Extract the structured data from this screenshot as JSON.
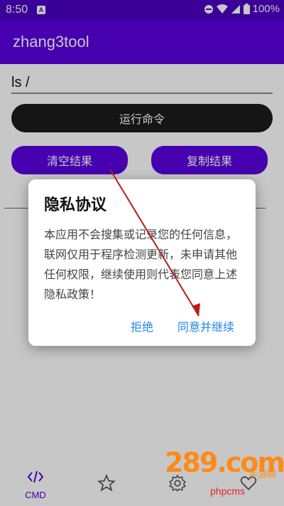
{
  "status_bar": {
    "time": "8:50",
    "notification_icon": "A",
    "battery": "100%"
  },
  "app_bar": {
    "title": "zhang3tool"
  },
  "command": {
    "value": "ls /"
  },
  "buttons": {
    "run": "运行命令",
    "clear": "清空结果",
    "copy": "复制结果"
  },
  "dialog": {
    "title": "隐私协议",
    "body": "本应用不会搜集或记录您的任何信息，联网仅用于程序检测更新，未申请其他任何权限，继续使用则代表您同意上述隐私政策！",
    "reject": "拒绝",
    "accept": "同意并继续"
  },
  "bottom_nav": {
    "cmd_label": "CMD"
  },
  "watermark": {
    "logo": "289.com",
    "sub": "手游网",
    "php": "phpcms"
  },
  "colors": {
    "primary": "#5a00e0",
    "status": "#4b00c2",
    "run_button": "#1c1c1c",
    "link": "#1e88e5",
    "annotation_arrow": "#b71c1c"
  }
}
